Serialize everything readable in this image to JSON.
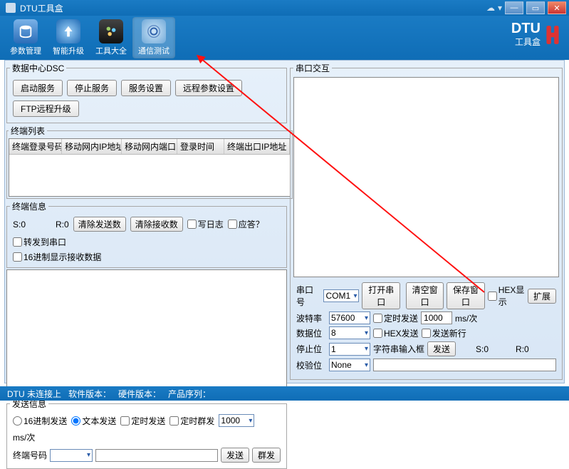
{
  "title": "DTU工具盒",
  "brand": {
    "main": "DTU",
    "sub": "工具盒"
  },
  "toolbar": [
    {
      "label": "参数管理",
      "icon": "db"
    },
    {
      "label": "智能升级",
      "icon": "up"
    },
    {
      "label": "工具大全",
      "icon": "tools"
    },
    {
      "label": "通信测试",
      "icon": "comm",
      "active": true
    }
  ],
  "dsc": {
    "legend": "数据中心DSC",
    "buttons": [
      "启动服务",
      "停止服务",
      "服务设置",
      "远程参数设置",
      "FTP远程升级"
    ]
  },
  "terminalList": {
    "legend": "终端列表",
    "columns": [
      "终端登录号码",
      "移动网内IP地址",
      "移动网内端口",
      "登录时间",
      "终端出口IP地址"
    ]
  },
  "terminalInfo": {
    "legend": "终端信息",
    "s_label": "S:0",
    "r_label": "R:0",
    "btn_clear_send": "清除发送数",
    "btn_clear_recv": "清除接收数",
    "chk_log": "写日志",
    "chk_answer": "应答？",
    "chk_forward": "转发到串口",
    "chk_hex_recv": "16进制显示接收数据"
  },
  "sendInfo": {
    "legend": "发送信息",
    "rb_hex": "16进制发送",
    "rb_text": "文本发送",
    "chk_timed": "定时发送",
    "chk_burst": "定时群发",
    "interval": "1000",
    "unit": "ms/次",
    "terminal_label": "终端号码",
    "btn_send": "发送",
    "btn_burst": "群发"
  },
  "serial": {
    "legend": "串口交互",
    "port_label": "串口号",
    "port": "COM1",
    "btn_open": "打开串口",
    "btn_clear_win": "清空窗口",
    "btn_save_win": "保存窗口",
    "chk_hex_disp": "HEX显示",
    "btn_ext": "扩展",
    "baud_label": "波特率",
    "baud": "57600",
    "chk_timed": "定时发送",
    "interval": "1000",
    "unit": "ms/次",
    "data_label": "数据位",
    "data": "8",
    "chk_hex_send": "HEX发送",
    "chk_newline": "发送新行",
    "stop_label": "停止位",
    "stop": "1",
    "str_label": "字符串输入框",
    "btn_send": "发送",
    "s_label": "S:0",
    "r_label": "R:0",
    "parity_label": "校验位",
    "parity": "None"
  },
  "status": {
    "dtu": "DTU 未连接上",
    "sw": "软件版本：",
    "hw": "硬件版本：",
    "sn": "产品序列："
  }
}
